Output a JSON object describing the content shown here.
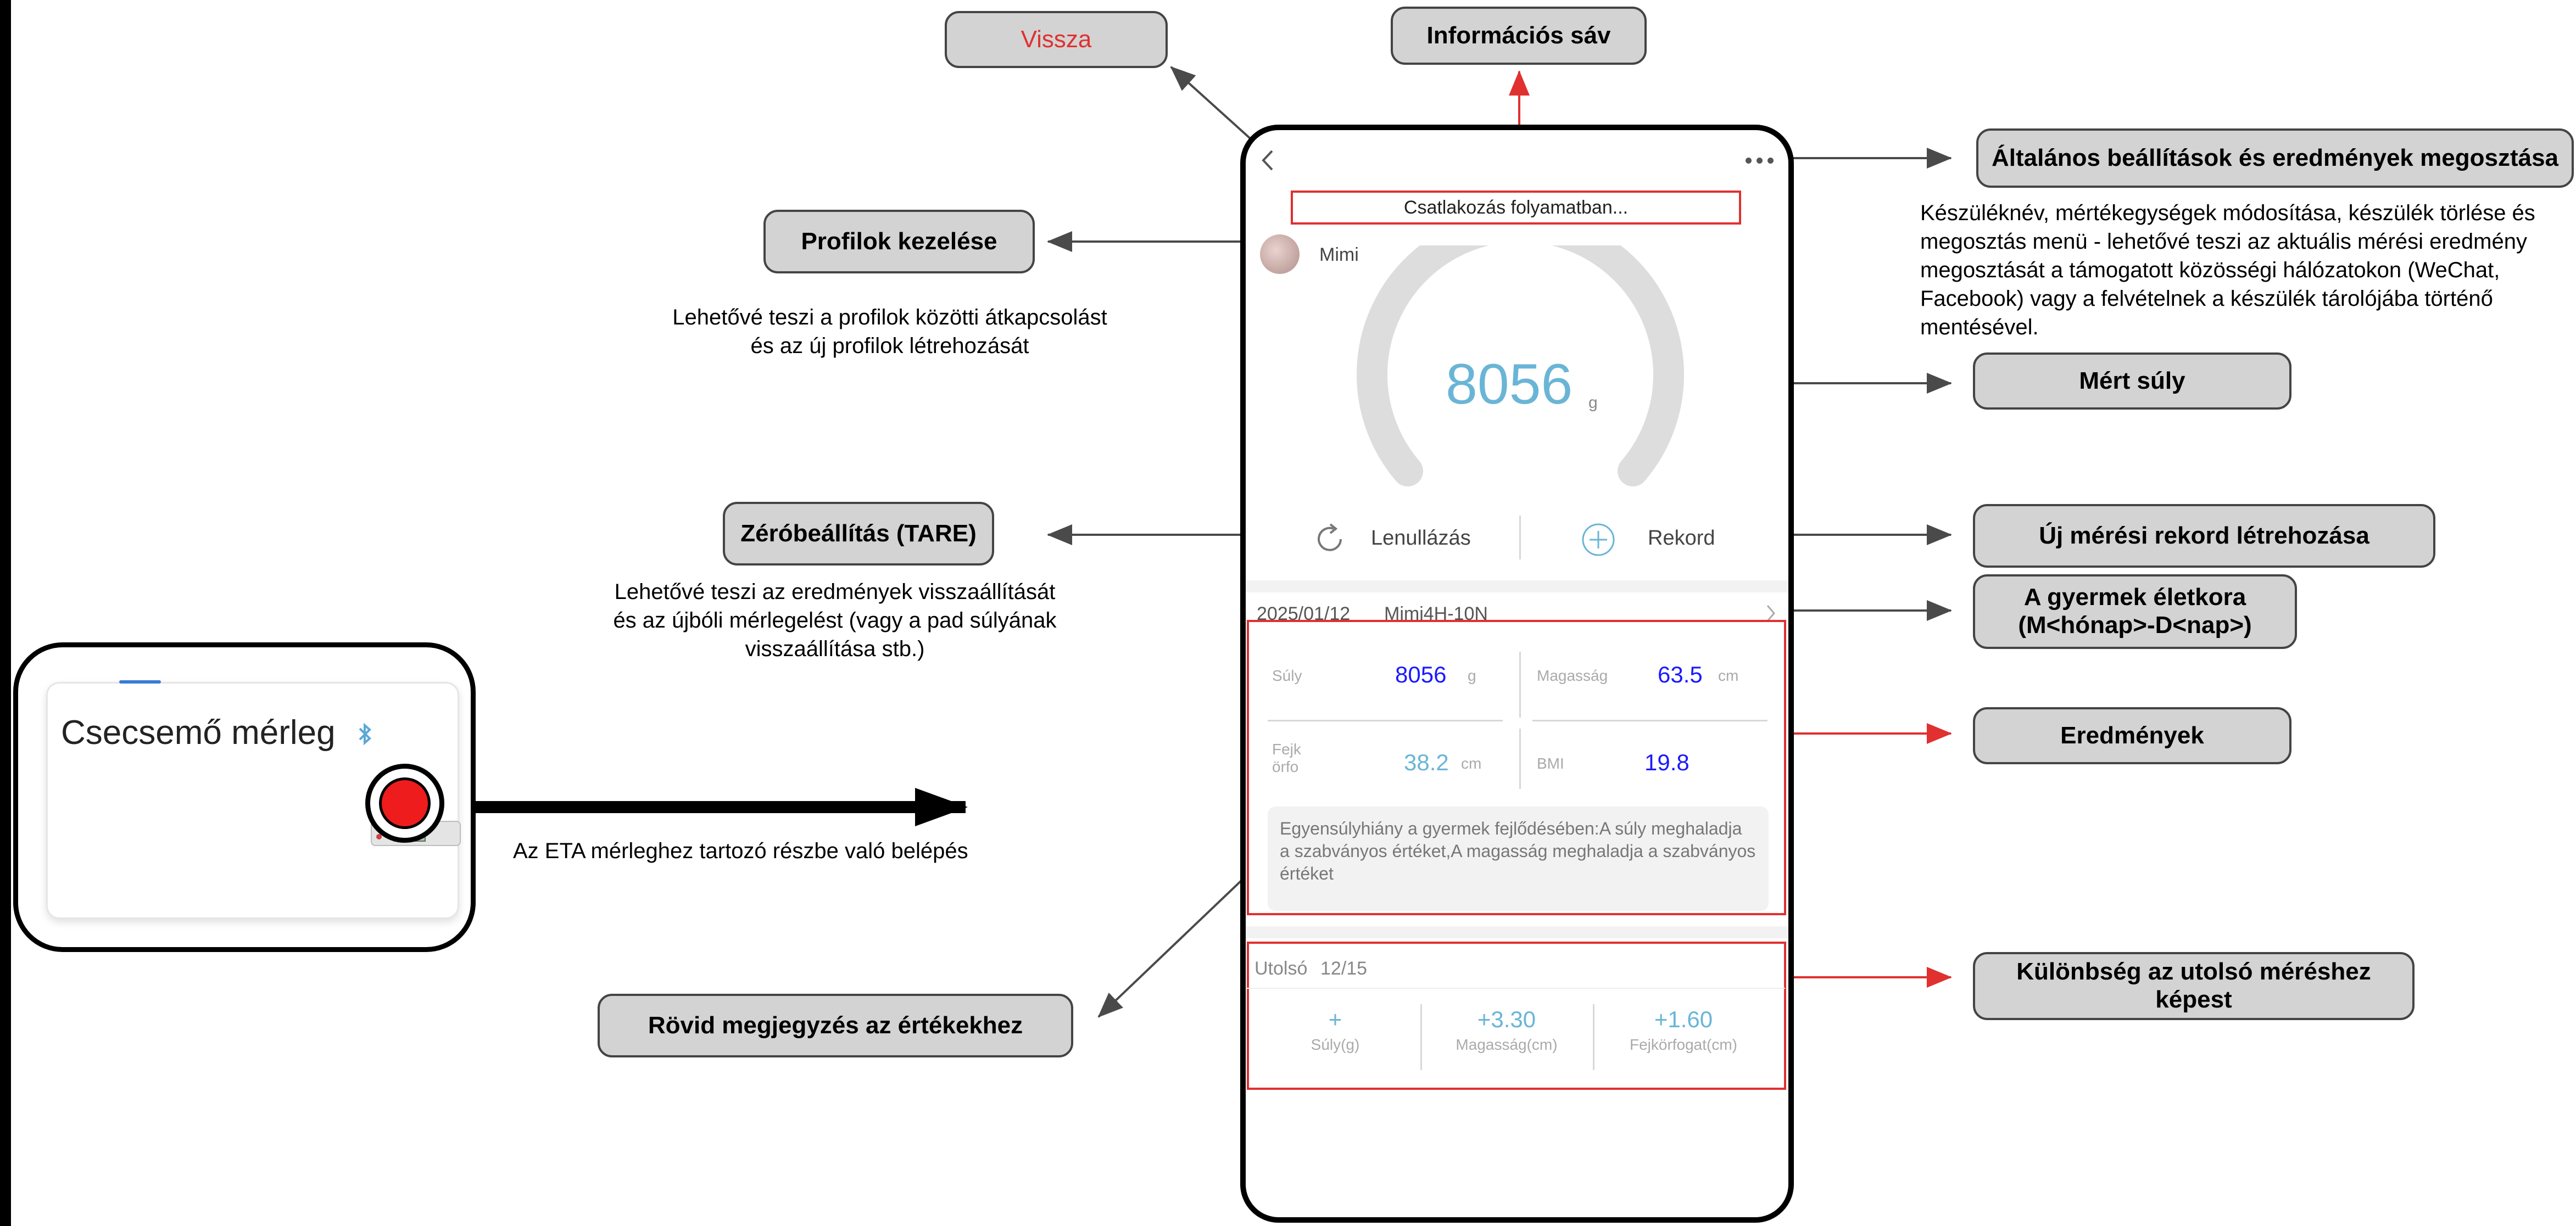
{
  "callouts": {
    "vissza": "Vissza",
    "info_bar": "Információs sáv",
    "general_settings": "Általános beállítások és eredmények megosztása",
    "profiles": "Profilok kezelése",
    "measured_weight": "Mért súly",
    "tare": "Zéróbeállítás (TARE)",
    "new_record": "Új mérési rekord létrehozása",
    "child_age_line1": "A gyermek életkora",
    "child_age_line2": "(M<hónap>-D<nap>)",
    "results": "Eredmények",
    "difference_line1": "Különbség az utolsó méréshez",
    "difference_line2": "képest",
    "short_note": "Rövid megjegyzés az értékekhez"
  },
  "descriptions": {
    "general_settings": [
      "Készüléknév, mértékegységek módosítása, készülék törlése és",
      "megosztás menü - lehetővé teszi az aktuális mérési eredmény",
      "megosztását a támogatott közösségi hálózatokon (WeChat,",
      "Facebook) vagy a felvételnek a készülék tárolójába történő",
      "mentésével."
    ],
    "profiles": [
      "Lehetővé teszi a profilok közötti átkapcsolást",
      "és az új profilok létrehozását"
    ],
    "tare": [
      "Lehetővé teszi az eredmények visszaállítását",
      "és az újbóli mérlegelést (vagy a pad súlyának",
      "visszaállítása stb.)"
    ],
    "eta_entry": "Az ETA mérleghez tartozó részbe való belépés"
  },
  "scale_card": {
    "title": "Csecsemő mérleg",
    "bluetooth_icon": "bluetooth-icon"
  },
  "phone": {
    "status_text": "Csatlakozás folyamatban...",
    "profile_name": "Mimi",
    "weight_value": "8056",
    "weight_unit": "g",
    "tare_label": "Lenullázás",
    "record_label": "Rekord",
    "date": "2025/01/12",
    "age": "Mimi4H-10N",
    "results": {
      "weight_label": "Súly",
      "weight_value": "8056",
      "weight_unit": "g",
      "height_label": "Magasság",
      "height_value": "63.5",
      "height_unit": "cm",
      "head_label": "Fejk\nörfo",
      "head_value": "38.2",
      "head_unit": "cm",
      "bmi_label": "BMI",
      "bmi_value": "19.8"
    },
    "note": "Egyensúlyhiány a gyermek fejlődésében:A súly meghaladja a szabványos értéket,A magasság meghaladja a szabványos értéket",
    "last": {
      "label": "Utolsó",
      "date": "12/15",
      "items": [
        {
          "value": "+",
          "label": "Súly(g)"
        },
        {
          "value": "+3.30",
          "label": "Magasság(cm)"
        },
        {
          "value": "+1.60",
          "label": "Fejkörfogat(cm)"
        }
      ]
    }
  },
  "colors": {
    "accent_blue": "#6ab5d6",
    "value_blue": "#1a1aff",
    "red": "#e03030",
    "callout_bg": "#d3d3d3"
  }
}
